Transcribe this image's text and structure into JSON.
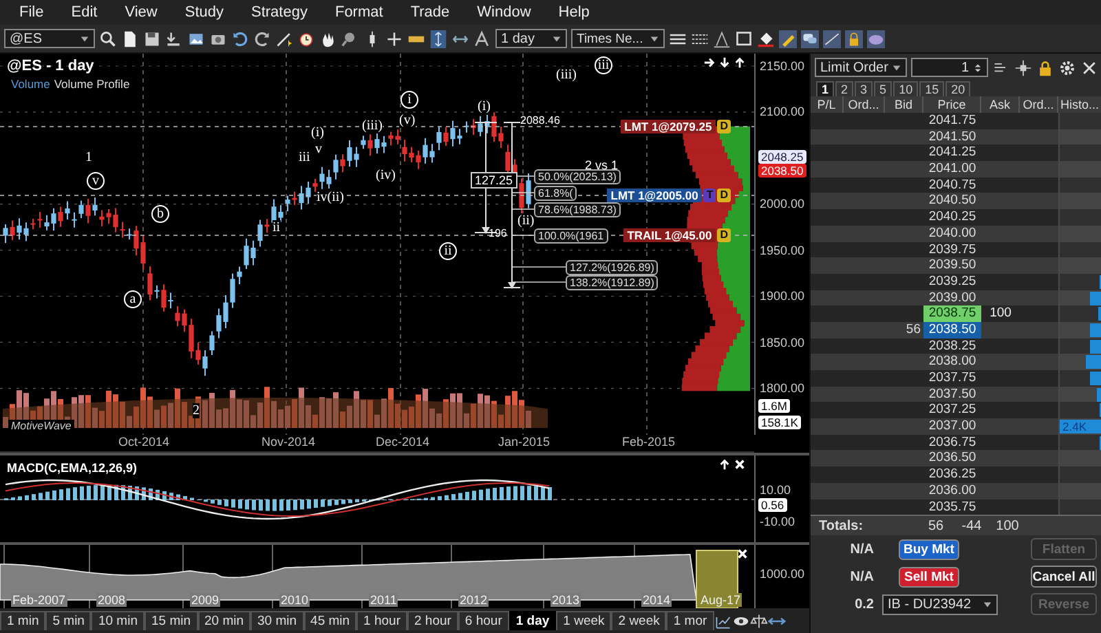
{
  "menu": [
    "File",
    "Edit",
    "View",
    "Study",
    "Strategy",
    "Format",
    "Trade",
    "Window",
    "Help"
  ],
  "toolbar": {
    "symbol": "@ES",
    "interval": "1 day",
    "font": "Times Ne..."
  },
  "chart": {
    "title": "@ES - 1 day",
    "legend": [
      "Volume",
      "Volume Profile"
    ],
    "logo": "MotiveWave",
    "price_axis": [
      "2150.00",
      "2100.00",
      "2000.00",
      "1950.00",
      "1900.00",
      "1850.00",
      "1800.00"
    ],
    "price_badges": [
      {
        "text": "2048.25",
        "kind": "price"
      },
      {
        "text": "2038.50",
        "kind": "last"
      },
      {
        "text": "1.6M",
        "kind": "volume"
      },
      {
        "text": "158.1K",
        "kind": "volume"
      }
    ],
    "dates": [
      "Oct-2014",
      "Nov-2014",
      "Dec-2014",
      "Jan-2015",
      "Feb-2015"
    ],
    "wave_labels": [
      {
        "text": "iii",
        "circled": true
      },
      {
        "text": "(iii)",
        "circled": false
      },
      {
        "text": "i",
        "circled": true
      },
      {
        "text": "(i)",
        "circled": false
      },
      {
        "text": "(v)",
        "circled": false
      },
      {
        "text": "(iii)",
        "circled": false
      },
      {
        "text": "(i)",
        "circled": false
      },
      {
        "text": "v",
        "circled": false
      },
      {
        "text": "1",
        "circled": false
      },
      {
        "text": "iii",
        "circled": false
      },
      {
        "text": "(iv)",
        "circled": false
      },
      {
        "text": "v",
        "circled": true
      },
      {
        "text": "iv(ii)",
        "circled": false
      },
      {
        "text": "b",
        "circled": true
      },
      {
        "text": "(ii)",
        "circled": false
      },
      {
        "text": "ii",
        "circled": false
      },
      {
        "text": "ii",
        "circled": true
      },
      {
        "text": "a",
        "circled": true
      },
      {
        "text": "2",
        "circled": false
      }
    ],
    "fib_levels": [
      "50.0%(2025.13)",
      "61.8%(",
      "78.6%(1988.73)",
      "100.0%(1961",
      "127.2%(1926.89)",
      "138.2%(1912.89)"
    ],
    "orders": [
      {
        "text": "LMT 1@2079.25",
        "color": "#8a1c1c",
        "badges": [
          {
            "text": "D",
            "color": "#d6b21e"
          }
        ]
      },
      {
        "text": "LMT 1@2005.00",
        "color": "#1d4f94",
        "badges": [
          {
            "text": "T",
            "color": "#5b3bb8"
          },
          {
            "text": "D",
            "color": "#d6b21e"
          }
        ]
      },
      {
        "text": "TRAIL 1@45.00",
        "color": "#8a1c1c",
        "badges": [
          {
            "text": "D",
            "color": "#d6b21e"
          }
        ]
      }
    ],
    "ratio": "2 vs 1",
    "range": "127.25",
    "high": "2088.46",
    "low": "196"
  },
  "macd": {
    "title": "MACD(C,EMA,12,26,9)",
    "axis": [
      "10.00",
      "-10.00"
    ],
    "badge": "0.56"
  },
  "overview": {
    "years": [
      "Feb-2007",
      "2008",
      "2009",
      "2010",
      "2011",
      "2012",
      "2013",
      "2014"
    ],
    "highlight": "Aug-17",
    "axis": "1000.00"
  },
  "timeframes": [
    {
      "label": "1 min",
      "selected": false
    },
    {
      "label": "5 min",
      "selected": false
    },
    {
      "label": "10 min",
      "selected": false
    },
    {
      "label": "15 min",
      "selected": false
    },
    {
      "label": "20 min",
      "selected": false
    },
    {
      "label": "30 min",
      "selected": false
    },
    {
      "label": "45 min",
      "selected": false
    },
    {
      "label": "1 hour",
      "selected": false
    },
    {
      "label": "2 hour",
      "selected": false
    },
    {
      "label": "6 hour",
      "selected": false
    },
    {
      "label": "1 day",
      "selected": true
    },
    {
      "label": "1 week",
      "selected": false
    },
    {
      "label": "2 week",
      "selected": false
    },
    {
      "label": "1 mor",
      "selected": false
    }
  ],
  "dom": {
    "order_type": "Limit Order",
    "quantity": "1",
    "tabs": [
      {
        "label": "1",
        "selected": true
      },
      {
        "label": "2",
        "selected": false
      },
      {
        "label": "3",
        "selected": false
      },
      {
        "label": "5",
        "selected": false
      },
      {
        "label": "10",
        "selected": false
      },
      {
        "label": "15",
        "selected": false
      },
      {
        "label": "20",
        "selected": false
      }
    ],
    "columns": [
      "P/L",
      "Ord...",
      "Bid",
      "Price",
      "Ask",
      "Ord...",
      "Histo..."
    ],
    "rows": [
      {
        "price": "2041.75",
        "kind": "plain"
      },
      {
        "price": "2041.50",
        "kind": "plain"
      },
      {
        "price": "2041.25",
        "kind": "plain"
      },
      {
        "price": "2041.00",
        "kind": "plain"
      },
      {
        "price": "2040.75",
        "kind": "plain"
      },
      {
        "price": "2040.50",
        "kind": "plain"
      },
      {
        "price": "2040.25",
        "kind": "plain"
      },
      {
        "price": "2040.00",
        "kind": "plain"
      },
      {
        "price": "2039.75",
        "kind": "plain"
      },
      {
        "price": "2039.50",
        "kind": "plain"
      },
      {
        "price": "2039.25",
        "kind": "plain",
        "level": 0.05
      },
      {
        "price": "2039.00",
        "kind": "plain",
        "level": 0.3
      },
      {
        "price": "2038.75",
        "kind": "best_ask",
        "ask": "100",
        "level": 0.1
      },
      {
        "price": "2038.50",
        "kind": "best_bid",
        "bid": "56",
        "level": 0.28
      },
      {
        "price": "2038.25",
        "kind": "plain",
        "level": 0.3
      },
      {
        "price": "2038.00",
        "kind": "plain",
        "level": 0.4
      },
      {
        "price": "2037.75",
        "kind": "plain",
        "level": 0.3
      },
      {
        "price": "2037.50",
        "kind": "plain",
        "level": 0.13
      },
      {
        "price": "2037.25",
        "kind": "plain",
        "level": 0.05
      },
      {
        "price": "2037.00",
        "kind": "plain",
        "level": 1,
        "history": "2.4K"
      },
      {
        "price": "2036.75",
        "kind": "plain",
        "level": 0.05
      },
      {
        "price": "2036.50",
        "kind": "plain"
      },
      {
        "price": "2036.25",
        "kind": "plain"
      },
      {
        "price": "2036.00",
        "kind": "plain"
      },
      {
        "price": "2035.75",
        "kind": "plain"
      }
    ],
    "totals": {
      "label": "Totals:",
      "bid": "56",
      "net": "-44",
      "ask": "100"
    },
    "action_rows": [
      {
        "value": "N/A",
        "button": {
          "label": "Buy Mkt",
          "kind": "buy"
        },
        "side": {
          "label": "Flatten",
          "disabled": true
        }
      },
      {
        "value": "N/A",
        "button": {
          "label": "Sell Mkt",
          "kind": "sell"
        },
        "side": {
          "label": "Cancel All",
          "disabled": false
        }
      },
      {
        "value": "0.2",
        "account": "IB - DU23942",
        "side": {
          "label": "Reverse",
          "disabled": true
        }
      }
    ]
  }
}
